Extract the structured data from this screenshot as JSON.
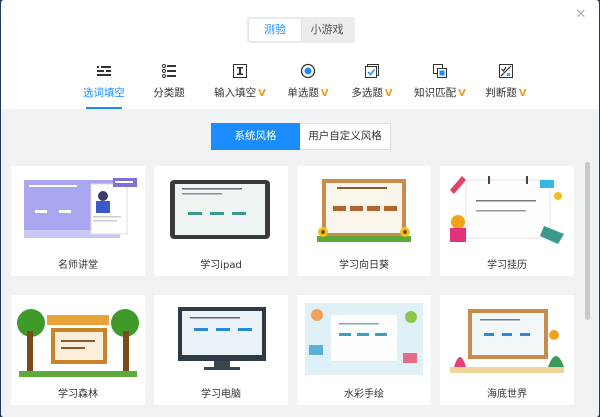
{
  "top_tabs": [
    {
      "label": "测验",
      "active": true
    },
    {
      "label": "小游戏",
      "active": false
    }
  ],
  "close_icon": "close-icon",
  "question_types": [
    {
      "label": "选词填空",
      "icon": "fill-blank-icon",
      "vip": false,
      "active": true
    },
    {
      "label": "分类题",
      "icon": "classify-icon",
      "vip": false,
      "active": false
    },
    {
      "label": "输入填空",
      "icon": "input-icon",
      "vip": true,
      "active": false
    },
    {
      "label": "单选题",
      "icon": "radio-icon",
      "vip": true,
      "active": false
    },
    {
      "label": "多选题",
      "icon": "checkbox-icon",
      "vip": true,
      "active": false
    },
    {
      "label": "知识匹配",
      "icon": "match-icon",
      "vip": true,
      "active": false
    },
    {
      "label": "判断题",
      "icon": "judge-icon",
      "vip": true,
      "active": false
    }
  ],
  "vip_mark": "V",
  "style_tabs": [
    {
      "label": "系统风格",
      "active": true
    },
    {
      "label": "用户自定义风格",
      "active": false
    }
  ],
  "templates": [
    {
      "name": "名师讲堂"
    },
    {
      "name": "学习ipad"
    },
    {
      "name": "学习向日葵"
    },
    {
      "name": "学习挂历"
    },
    {
      "name": "学习森林"
    },
    {
      "name": "学习电脑"
    },
    {
      "name": "水彩手绘"
    },
    {
      "name": "海底世界"
    }
  ],
  "colors": {
    "accent": "#1a8cff",
    "vip": "#e8a21a"
  }
}
